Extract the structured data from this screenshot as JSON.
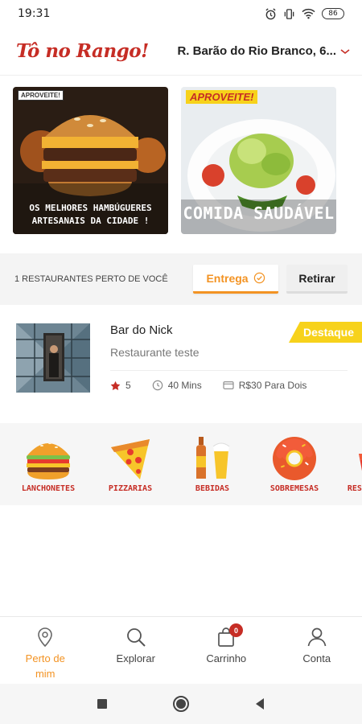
{
  "status_bar": {
    "time": "19:31",
    "battery": "86"
  },
  "header": {
    "logo": "Tô no Rango!",
    "address": "R. Barão do Rio Branco, 6..."
  },
  "banners": [
    {
      "tag": "APROVEITE!",
      "caption": "OS MELHORES HAMBÚGUERES ARTESANAIS DA CIDADE !"
    },
    {
      "tag": "APROVEITE!",
      "caption": "COMIDA SAUDÁVEL"
    }
  ],
  "filter": {
    "count_text": "1 RESTAURANTES PERTO DE VOCÊ",
    "delivery_label": "Entrega",
    "pickup_label": "Retirar"
  },
  "restaurant": {
    "name": "Bar do Nick",
    "description": "Restaurante teste",
    "badge": "Destaque",
    "rating": "5",
    "time": "40 Mins",
    "price": "R$30 Para Dois"
  },
  "categories": [
    {
      "label": "LANCHONETES",
      "icon": "burger-icon"
    },
    {
      "label": "PIZZARIAS",
      "icon": "pizza-icon"
    },
    {
      "label": "BEBIDAS",
      "icon": "drinks-icon"
    },
    {
      "label": "SOBREMESAS",
      "icon": "donut-icon"
    },
    {
      "label": "RESTAURANTES",
      "icon": "salad-icon"
    }
  ],
  "bottom_nav": [
    {
      "label": "Perto de mim",
      "icon": "location-pin-icon",
      "active": true
    },
    {
      "label": "Explorar",
      "icon": "search-icon",
      "active": false
    },
    {
      "label": "Carrinho",
      "icon": "cart-icon",
      "active": false,
      "badge": "0"
    },
    {
      "label": "Conta",
      "icon": "user-icon",
      "active": false
    }
  ],
  "colors": {
    "brand_red": "#c62d25",
    "accent_orange": "#f39323",
    "badge_yellow": "#f7d21b"
  }
}
